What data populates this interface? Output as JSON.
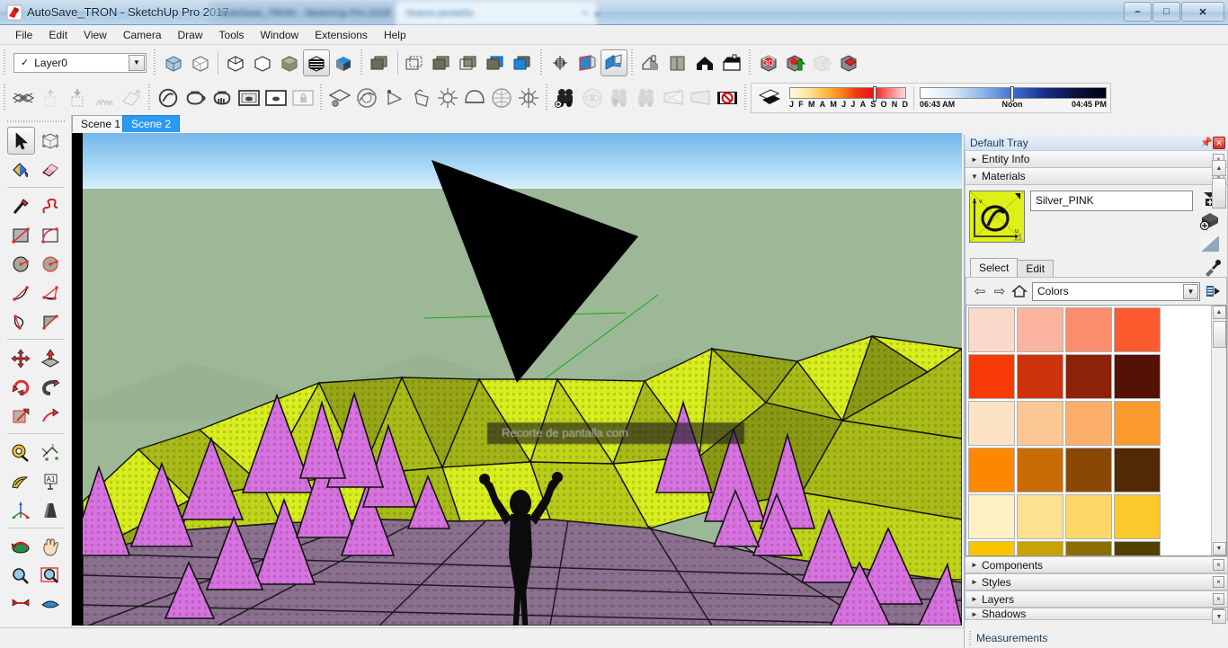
{
  "window": {
    "title": "AutoSave_TRON - SketchUp Pro 2017",
    "app_icon": "sketchup-icon",
    "minimize_label": "–",
    "maximize_label": "□",
    "close_label": "✕",
    "tabs": [
      {
        "label": "AutoSave_TRON - SketchUp Pro 2017",
        "active": false,
        "close": "×"
      },
      {
        "label": "Nueva pestaña",
        "active": true,
        "close": "×"
      }
    ],
    "new_tab_label": "+"
  },
  "menu": {
    "items": [
      "File",
      "Edit",
      "View",
      "Camera",
      "Draw",
      "Tools",
      "Window",
      "Extensions",
      "Help"
    ]
  },
  "toolbars": {
    "layer_combo": {
      "check": "✓",
      "value": "Layer0",
      "arrow": "▼"
    },
    "styles_group": [
      {
        "name": "style-xray",
        "state": "normal"
      },
      {
        "name": "style-wireframe",
        "state": "normal"
      },
      {
        "name": "style-hidden-line",
        "state": "normal"
      },
      {
        "name": "style-shaded",
        "state": "normal"
      },
      {
        "name": "style-shaded-texture",
        "state": "normal"
      },
      {
        "name": "style-monochrome",
        "state": "active"
      },
      {
        "name": "style-back-edges",
        "state": "normal"
      }
    ],
    "section_group": [
      {
        "name": "section-plane-tool"
      },
      {
        "name": "display-section-planes"
      },
      {
        "name": "display-section-cuts"
      },
      {
        "name": "display-section-fill"
      },
      {
        "name": "section-plane-blue-1"
      },
      {
        "name": "section-plane-blue-2"
      }
    ],
    "views_group": [
      {
        "name": "orbit-iso-icon"
      },
      {
        "name": "standard-view-front"
      },
      {
        "name": "standard-view-iso",
        "state": "active"
      }
    ],
    "walkthrough_group": [
      {
        "name": "view-iso-house"
      },
      {
        "name": "view-top"
      },
      {
        "name": "view-front-house"
      },
      {
        "name": "view-right"
      },
      {
        "name": "view-back"
      },
      {
        "name": "view-left"
      }
    ],
    "warehouse_group": [
      {
        "name": "3d-warehouse-icon"
      },
      {
        "name": "share-model-icon"
      },
      {
        "name": "share-component-icon",
        "state": "dim"
      },
      {
        "name": "extension-warehouse-icon"
      }
    ],
    "row2_left": [
      {
        "name": "hide-icon"
      },
      {
        "name": "unhide-icon",
        "state": "dim"
      },
      {
        "name": "unhide-all-icon",
        "state": "dim"
      },
      {
        "name": "sandbox-grass-icon",
        "state": "dim"
      },
      {
        "name": "sandbox-drape-icon",
        "state": "dim"
      }
    ],
    "solid_group": [
      {
        "name": "solid-tools-outer-shell"
      },
      {
        "name": "solid-intersect"
      },
      {
        "name": "solid-union"
      }
    ],
    "dynamic_group": [
      {
        "name": "dyn-component-options"
      },
      {
        "name": "dyn-component-interact"
      },
      {
        "name": "dyn-component-lock",
        "state": "dim"
      }
    ],
    "sandbox_group": [
      {
        "name": "sandbox-from-scratch"
      },
      {
        "name": "sandbox-from-contours"
      },
      {
        "name": "sandbox-smoove"
      },
      {
        "name": "sandbox-stamp"
      },
      {
        "name": "sandbox-drape-2"
      },
      {
        "name": "sandbox-add-detail"
      },
      {
        "name": "sandbox-flip-edge"
      },
      {
        "name": "sandbox-sphere"
      }
    ],
    "advanced_camera": [
      {
        "name": "add-camera-icon"
      },
      {
        "name": "lock-camera-icon",
        "state": "dim"
      },
      {
        "name": "look-through-camera-icon",
        "state": "dim"
      },
      {
        "name": "edit-camera-icon",
        "state": "dim"
      },
      {
        "name": "show-frustum-icon",
        "state": "dim"
      },
      {
        "name": "hide-frustum-icon",
        "state": "dim"
      },
      {
        "name": "toggle-camera-icon"
      }
    ],
    "shadows": {
      "toggle_name": "shadow-toggle-icon",
      "date_ticks": [
        "J",
        "F",
        "M",
        "A",
        "M",
        "J",
        "J",
        "A",
        "S",
        "O",
        "N",
        "D"
      ],
      "time_start": "06:43 AM",
      "time_noon": "Noon",
      "time_end": "04:45 PM"
    }
  },
  "scenes": {
    "tabs": [
      {
        "label": "Scene 1",
        "active": false
      },
      {
        "label": "Scene 2",
        "active": true
      }
    ]
  },
  "left_toolbar": {
    "groups": [
      [
        {
          "name": "select-tool",
          "state": "active"
        },
        {
          "name": "make-component-tool"
        }
      ],
      [
        {
          "name": "paint-bucket-tool"
        },
        {
          "name": "eraser-tool"
        }
      ],
      [
        {
          "name": "line-tool"
        },
        {
          "name": "freehand-tool"
        },
        {
          "name": "rectangle-tool"
        },
        {
          "name": "rotated-rectangle-tool"
        },
        {
          "name": "circle-tool"
        },
        {
          "name": "polygon-tool"
        },
        {
          "name": "arc-tool"
        },
        {
          "name": "two-point-arc-tool"
        },
        {
          "name": "three-point-arc-tool"
        },
        {
          "name": "pie-tool"
        }
      ],
      [
        {
          "name": "move-tool"
        },
        {
          "name": "push-pull-tool"
        },
        {
          "name": "rotate-tool"
        },
        {
          "name": "follow-me-tool"
        },
        {
          "name": "scale-tool"
        },
        {
          "name": "offset-tool"
        }
      ],
      [
        {
          "name": "tape-measure-tool"
        },
        {
          "name": "dimension-tool"
        },
        {
          "name": "protractor-tool"
        },
        {
          "name": "text-tool"
        },
        {
          "name": "axes-tool"
        },
        {
          "name": "3d-text-tool"
        }
      ],
      [
        {
          "name": "orbit-tool"
        },
        {
          "name": "pan-tool"
        },
        {
          "name": "zoom-tool"
        },
        {
          "name": "zoom-extents-tool",
          "state": "selected-red"
        },
        {
          "name": "zoom-window-tool"
        },
        {
          "name": "previous-view-tool"
        }
      ]
    ]
  },
  "viewport": {
    "overlay_text": "Recorte de pantalla com",
    "sky_color": "#8fc8f0",
    "ground_color": "#9cb897",
    "terrain_light": "#d8ee1e",
    "terrain_dark": "#9aa81a",
    "tree_color": "#d772e0",
    "floor_color": "#8b6f8e",
    "figure_color": "#0a0a0a",
    "guide_line_color": "#00a800"
  },
  "tray": {
    "title": "Default Tray",
    "pin_icon": "pin-icon",
    "close_icon": "close-icon",
    "panels_top": [
      {
        "label": "Entity Info",
        "expanded": false,
        "tri": "►",
        "close": "×"
      },
      {
        "label": "Materials",
        "expanded": true,
        "tri": "▼",
        "close": "×"
      }
    ],
    "materials": {
      "selected_swatch_color": "#dff018",
      "swatch_icon": "material-preview-icon",
      "name_value": "Silver_PINK",
      "side_buttons": [
        {
          "name": "create-material-icon"
        },
        {
          "name": "paint-bucket-add-icon"
        },
        {
          "name": "display-secondary-selection-icon"
        }
      ],
      "eyedropper": "eyedropper-icon",
      "tabs": [
        {
          "label": "Select",
          "active": true
        },
        {
          "label": "Edit",
          "active": false
        }
      ],
      "nav": {
        "back": "⇦",
        "forward": "⇨",
        "home": "home-icon",
        "library": "Colors",
        "library_arrow": "▼",
        "details": "details-icon"
      },
      "swatches": [
        "#fbd9cb",
        "#fbb4a0",
        "#fb8d6e",
        "#fb5a2e",
        "#f83b06",
        "#cd330c",
        "#8d2208",
        "#551105",
        "#fce3c5",
        "#fcc794",
        "#fcaf6a",
        "#fb9a2d",
        "#fb8800",
        "#c96c06",
        "#8a4806",
        "#522905",
        "#fdf0c4",
        "#fce193",
        "#fcd869",
        "#fbc92a",
        "#fbc400",
        "#c9a205",
        "#8a6e05",
        "#524003"
      ],
      "scroll": {
        "up": "▲",
        "down": "▼"
      }
    },
    "panels_bottom": [
      {
        "label": "Components",
        "tri": "►",
        "close": "×"
      },
      {
        "label": "Styles",
        "tri": "►",
        "close": "×"
      },
      {
        "label": "Layers",
        "tri": "►",
        "close": "×"
      },
      {
        "label": "Shadows",
        "tri": "►",
        "close": "×"
      }
    ],
    "scroll_down": "▼"
  },
  "status": {
    "measurements_label": "Measurements",
    "measurements_value": ""
  }
}
